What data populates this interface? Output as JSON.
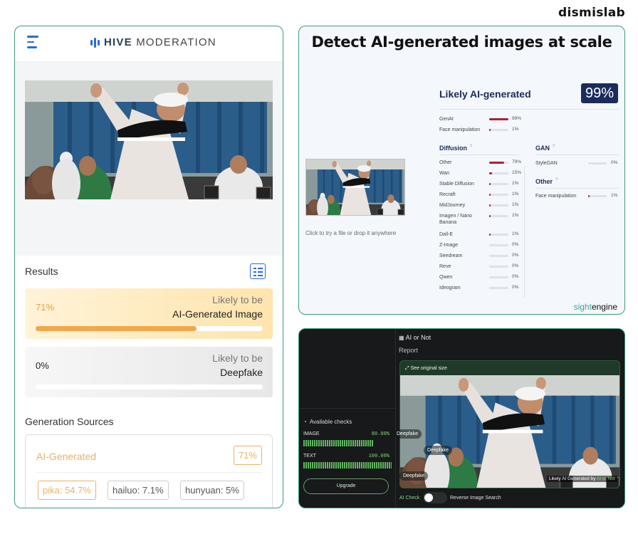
{
  "brand": "dismislab",
  "hive": {
    "logo_bold": "HIVE",
    "logo_light": "MODERATION",
    "results_title": "Results",
    "ai_card": {
      "percent": "71%",
      "line1": "Likely to be",
      "line2": "AI-Generated Image",
      "fill": 0.71
    },
    "deepfake_card": {
      "percent": "0%",
      "line1": "Likely to be",
      "line2": "Deepfake",
      "fill": 0
    },
    "generation_title": "Generation Sources",
    "gen_label": "AI-Generated",
    "gen_percent": "71%",
    "tags": [
      "pika: 54.7%",
      "hailuo: 7.1%",
      "hunyuan: 5%"
    ]
  },
  "sightengine": {
    "title": "Detect AI-generated images at scale",
    "caption": "Click to try a file or drop it anywhere",
    "likely": "Likely AI-generated",
    "score": "99%",
    "top_rows": [
      {
        "name": "GenAI",
        "value": "99%",
        "fill": 0.99
      },
      {
        "name": "Face manipulation",
        "value": "1%",
        "fill": 0.01
      }
    ],
    "diffusion_title": "Diffusion",
    "diffusion_rows": [
      {
        "name": "Other",
        "value": "79%",
        "fill": 0.79
      },
      {
        "name": "Wan",
        "value": "15%",
        "fill": 0.15
      },
      {
        "name": "Stable Diffusion",
        "value": "1%",
        "fill": 0.01
      },
      {
        "name": "Recraft",
        "value": "1%",
        "fill": 0.01
      },
      {
        "name": "MidJourney",
        "value": "1%",
        "fill": 0.01
      },
      {
        "name": "Imagen / Nano Banana",
        "value": "1%",
        "fill": 0.01
      },
      {
        "name": "Dall-E",
        "value": "1%",
        "fill": 0.01
      },
      {
        "name": "Z-Image",
        "value": "0%",
        "fill": 0
      },
      {
        "name": "Seedream",
        "value": "0%",
        "fill": 0
      },
      {
        "name": "Reve",
        "value": "0%",
        "fill": 0
      },
      {
        "name": "Qwen",
        "value": "0%",
        "fill": 0
      },
      {
        "name": "Ideogram",
        "value": "0%",
        "fill": 0
      }
    ],
    "gan_title": "GAN",
    "gan_rows": [
      {
        "name": "StyleGAN",
        "value": "0%",
        "fill": 0
      }
    ],
    "other_title": "Other",
    "other_rows": [
      {
        "name": "Face manipulation",
        "value": "1%",
        "fill": 0.01
      }
    ],
    "brand_light": "sight",
    "brand_bold": "engine"
  },
  "aiornot": {
    "title": "AI or Not",
    "report": "Report",
    "see_original": "See original size",
    "available_checks": "Available checks",
    "image_label": "IMAGE",
    "image_value": "80.00%",
    "image_fill": 0.8,
    "text_label": "TEXT",
    "text_value": "100.00%",
    "text_fill": 1.0,
    "upgrade": "Upgrade",
    "deepfake_tag": "Deepfake",
    "generated_by": "Likely AI Generated by",
    "ai_check": "AI Check",
    "reverse_search": "Reverse Image Search",
    "colors": {
      "accent": "#7edb7e"
    }
  }
}
